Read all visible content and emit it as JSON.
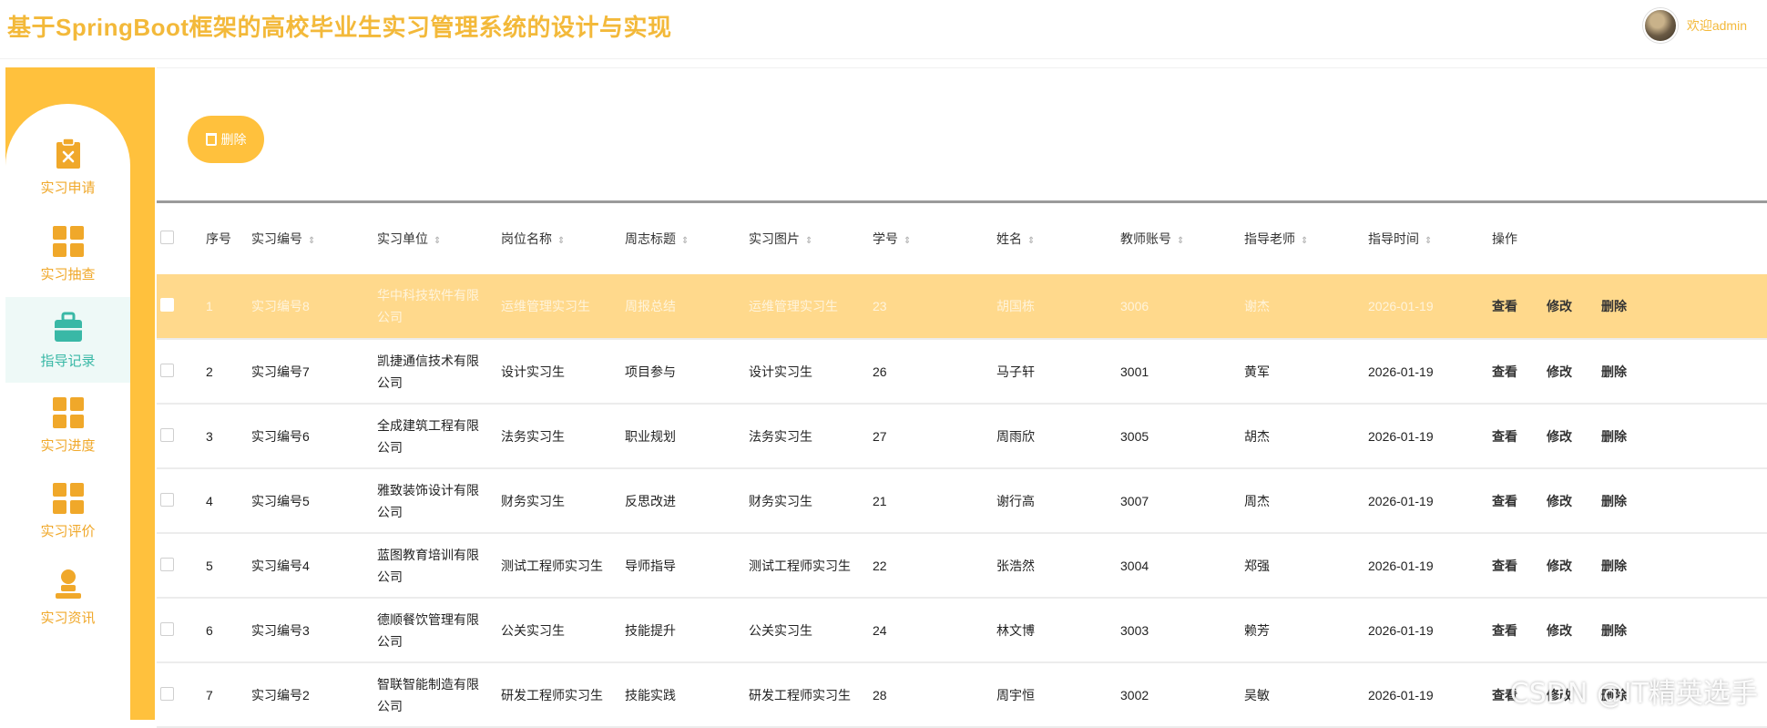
{
  "app": {
    "title": "基于SpringBoot框架的高校毕业生实习管理系统的设计与实现"
  },
  "user": {
    "name": "欢迎admin"
  },
  "sidebar": {
    "items": [
      {
        "label": "实习申请",
        "icon": "clipboard-icon",
        "active": false
      },
      {
        "label": "实习抽查",
        "icon": "grid-icon",
        "active": false
      },
      {
        "label": "指导记录",
        "icon": "briefcase-icon",
        "active": true
      },
      {
        "label": "实习进度",
        "icon": "grid-icon",
        "active": false
      },
      {
        "label": "实习评价",
        "icon": "grid-icon",
        "active": false
      },
      {
        "label": "实习资讯",
        "icon": "person-icon",
        "active": false
      }
    ]
  },
  "toolbar": {
    "delete_label": "删除"
  },
  "table": {
    "columns": [
      "序号",
      "实习编号",
      "实习单位",
      "岗位名称",
      "周志标题",
      "实习图片",
      "学号",
      "姓名",
      "教师账号",
      "指导老师",
      "指导时间",
      "操作"
    ],
    "actions": [
      "查看",
      "修改",
      "删除"
    ],
    "rows": [
      {
        "no": "1",
        "code": "实习编号8",
        "unit_line1": "华中科技软件有限",
        "unit_line2": "公司",
        "position": "运维管理实习生",
        "weekly": "周报总结",
        "image": "运维管理实习生",
        "student_id": "23",
        "name": "胡国栋",
        "teacher_id": "3006",
        "teacher": "谢杰",
        "time": "2026-01-19"
      },
      {
        "no": "2",
        "code": "实习编号7",
        "unit_line1": "凯捷通信技术有限",
        "unit_line2": "公司",
        "position": "设计实习生",
        "weekly": "项目参与",
        "image": "设计实习生",
        "student_id": "26",
        "name": "马子轩",
        "teacher_id": "3001",
        "teacher": "黄军",
        "time": "2026-01-19"
      },
      {
        "no": "3",
        "code": "实习编号6",
        "unit_line1": "全成建筑工程有限",
        "unit_line2": "公司",
        "position": "法务实习生",
        "weekly": "职业规划",
        "image": "法务实习生",
        "student_id": "27",
        "name": "周雨欣",
        "teacher_id": "3005",
        "teacher": "胡杰",
        "time": "2026-01-19"
      },
      {
        "no": "4",
        "code": "实习编号5",
        "unit_line1": "雅致装饰设计有限",
        "unit_line2": "公司",
        "position": "财务实习生",
        "weekly": "反思改进",
        "image": "财务实习生",
        "student_id": "21",
        "name": "谢行高",
        "teacher_id": "3007",
        "teacher": "周杰",
        "time": "2026-01-19"
      },
      {
        "no": "5",
        "code": "实习编号4",
        "unit_line1": "蓝图教育培训有限",
        "unit_line2": "公司",
        "position": "测试工程师实习生",
        "weekly": "导师指导",
        "image": "测试工程师实习生",
        "student_id": "22",
        "name": "张浩然",
        "teacher_id": "3004",
        "teacher": "郑强",
        "time": "2026-01-19"
      },
      {
        "no": "6",
        "code": "实习编号3",
        "unit_line1": "德顺餐饮管理有限",
        "unit_line2": "公司",
        "position": "公关实习生",
        "weekly": "技能提升",
        "image": "公关实习生",
        "student_id": "24",
        "name": "林文博",
        "teacher_id": "3003",
        "teacher": "赖芳",
        "time": "2026-01-19"
      },
      {
        "no": "7",
        "code": "实习编号2",
        "unit_line1": "智联智能制造有限",
        "unit_line2": "公司",
        "position": "研发工程师实习生",
        "weekly": "技能实践",
        "image": "研发工程师实习生",
        "student_id": "28",
        "name": "周宇恒",
        "teacher_id": "3002",
        "teacher": "吴敏",
        "time": "2026-01-19"
      }
    ]
  },
  "watermark": "CSDN @IT精英选手",
  "colors": {
    "accent": "#ffc13d",
    "title": "#f3b93a",
    "active": "#39b8a6",
    "highlight_row": "#ffd98c"
  }
}
